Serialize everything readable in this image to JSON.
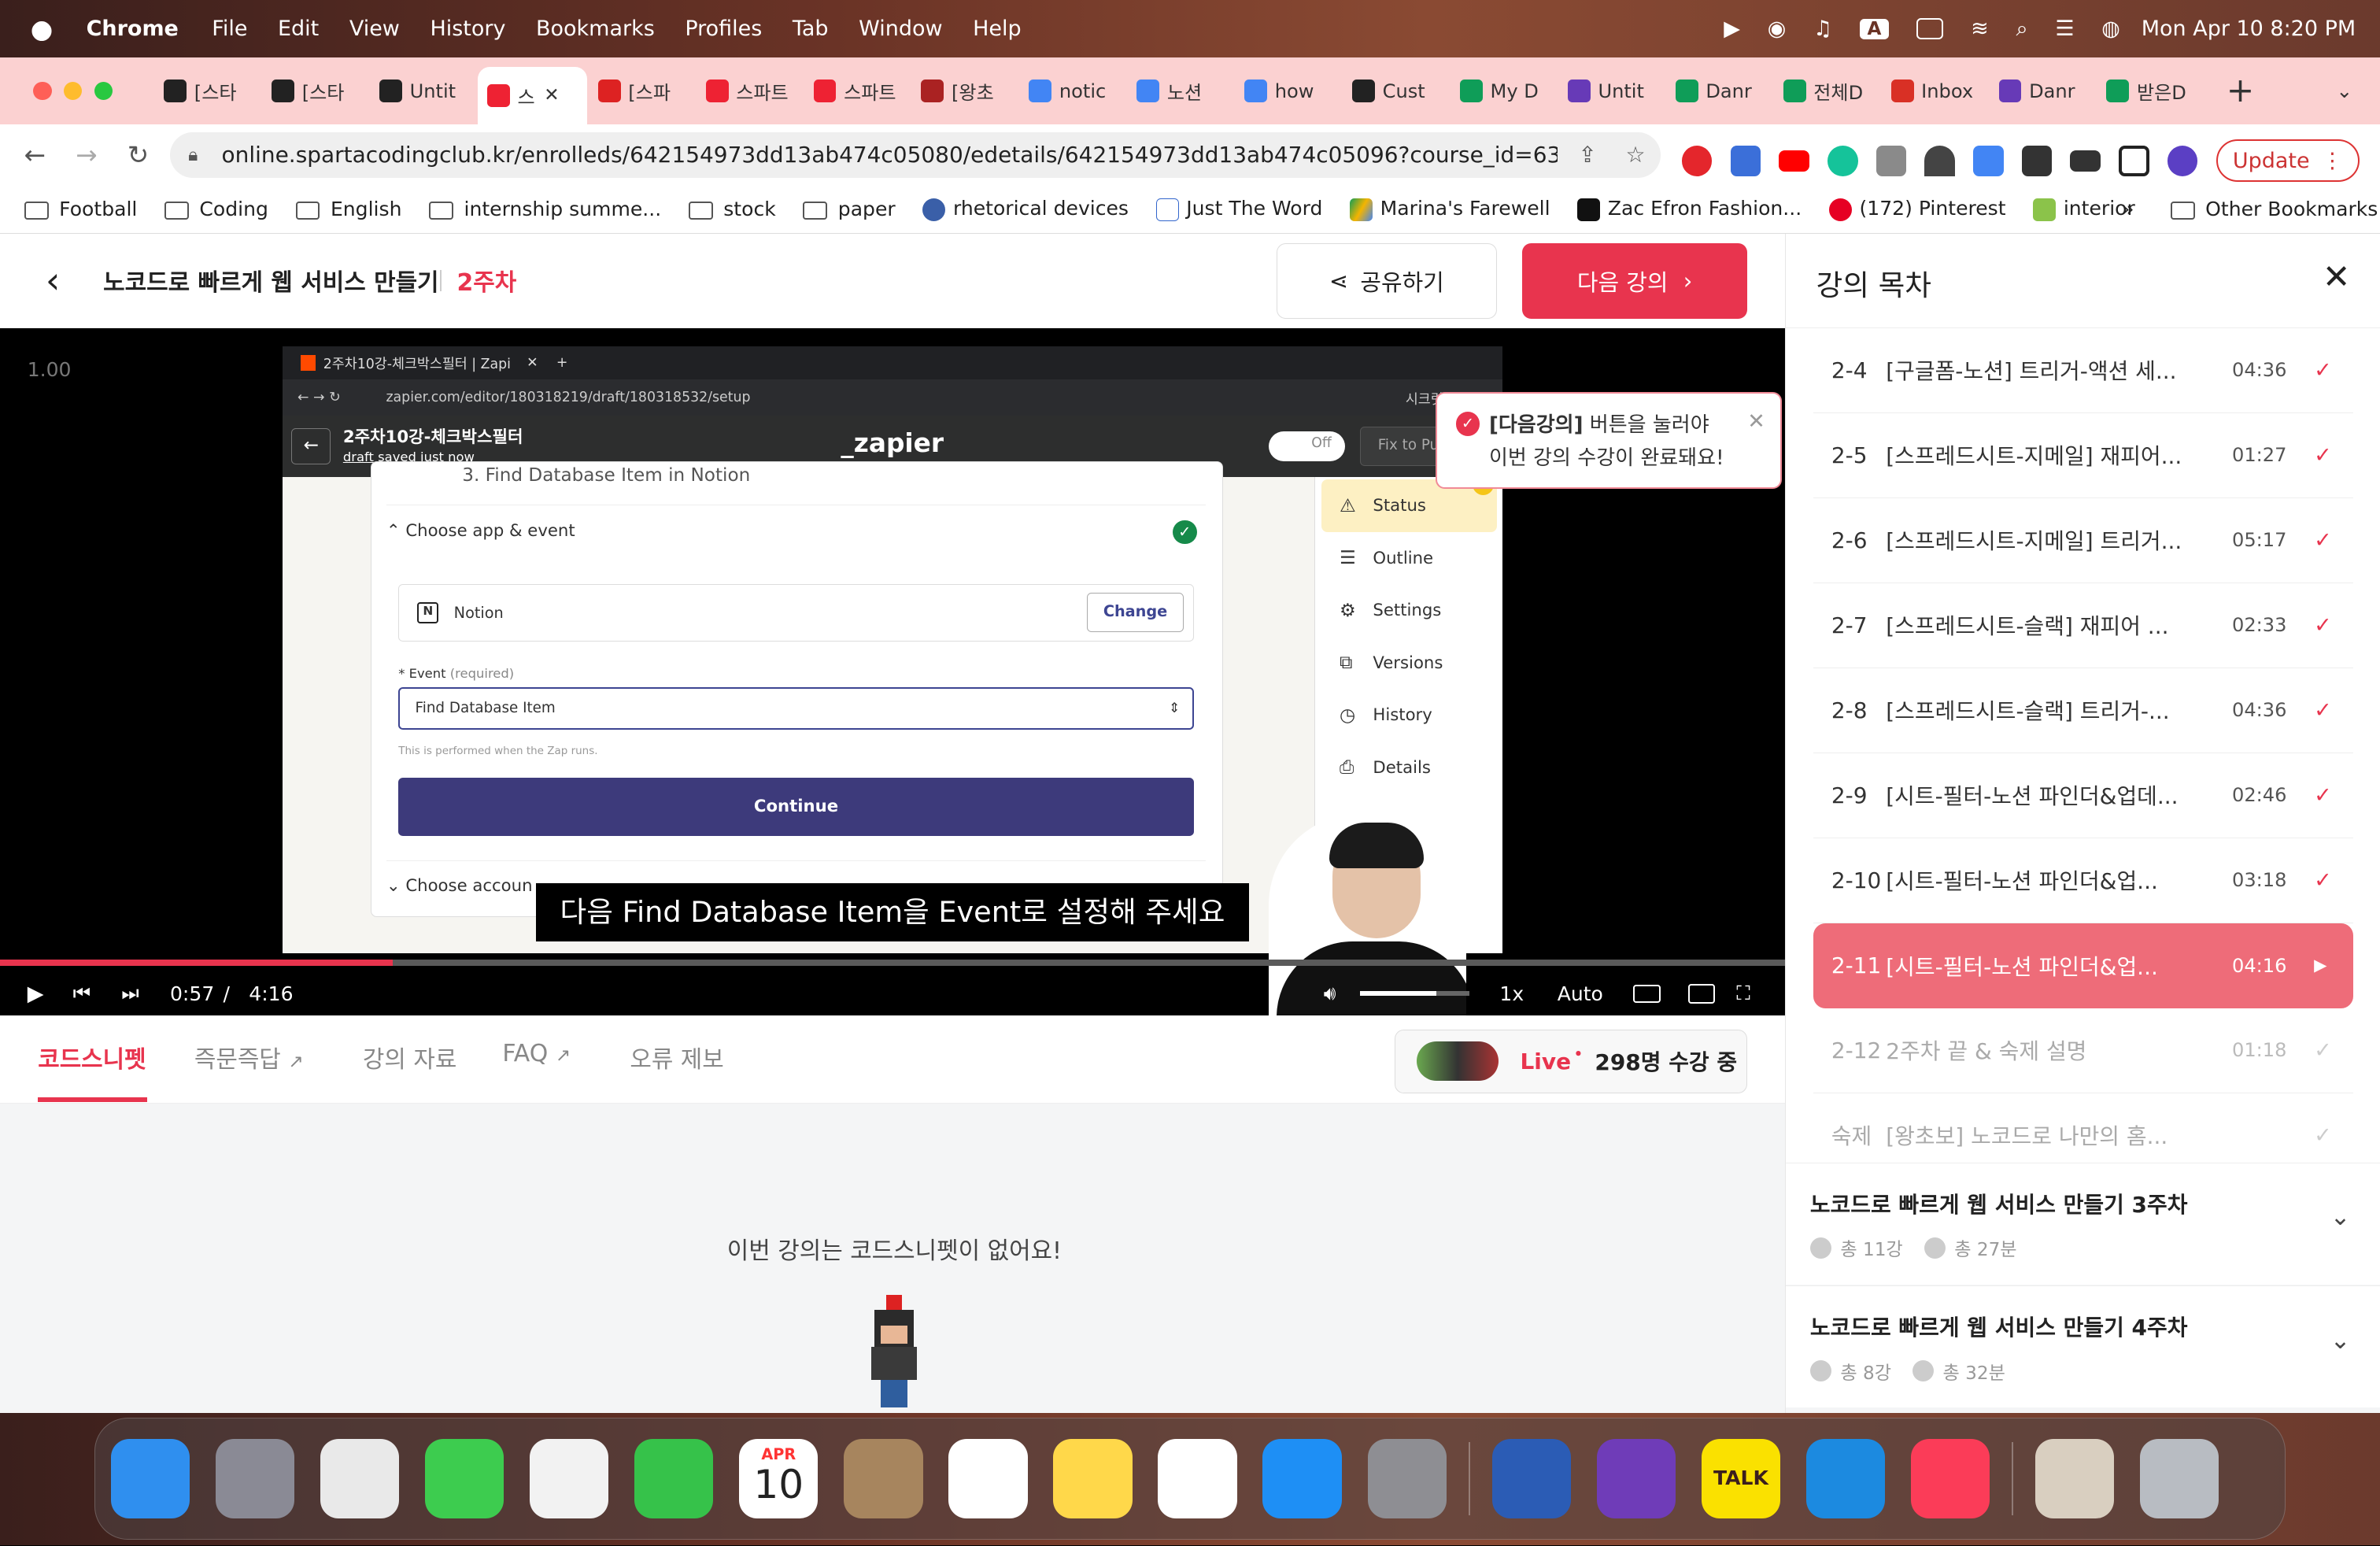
{
  "menubar": {
    "app": "Chrome",
    "items": [
      "File",
      "Edit",
      "View",
      "History",
      "Bookmarks",
      "Profiles",
      "Tab",
      "Window",
      "Help"
    ],
    "clock": "Mon Apr 10  8:20 PM",
    "input_indicator": "A"
  },
  "tabs": [
    {
      "label": "[스타",
      "color": "#222"
    },
    {
      "label": "[스타",
      "color": "#222"
    },
    {
      "label": "Untit",
      "color": "#222"
    },
    {
      "label": "스",
      "color": "#e23",
      "active": true
    },
    {
      "label": "[스파",
      "color": "#d22"
    },
    {
      "label": "스파트",
      "color": "#e23"
    },
    {
      "label": "스파트",
      "color": "#e23"
    },
    {
      "label": "[왕초",
      "color": "#a22"
    },
    {
      "label": "notic",
      "color": "#4285f4"
    },
    {
      "label": "노션",
      "color": "#4285f4"
    },
    {
      "label": "how",
      "color": "#4285f4"
    },
    {
      "label": "Cust",
      "color": "#222"
    },
    {
      "label": "My D",
      "color": "#0f9d58"
    },
    {
      "label": "Untit",
      "color": "#673ab7"
    },
    {
      "label": "Danr",
      "color": "#0f9d58"
    },
    {
      "label": "전체D",
      "color": "#0f9d58"
    },
    {
      "label": "Inbox",
      "color": "#d93025"
    },
    {
      "label": "Danr",
      "color": "#673ab7"
    },
    {
      "label": "받은D",
      "color": "#0f9d58"
    }
  ],
  "url": "online.spartacodingclub.kr/enrolleds/642154973dd13ab474c05080/edetails/642154973dd13ab474c05096?course_id=63d8e...",
  "update_label": "Update",
  "bookmarks": [
    "Football",
    "Coding",
    "English",
    "internship summe...",
    "stock",
    "paper",
    "rhetorical devices",
    "Just The Word",
    "Marina's Farewell",
    "Zac Efron Fashion...",
    "(172) Pinterest",
    "interior"
  ],
  "bookmarks_more": "»",
  "other_bookmarks": "Other Bookmarks",
  "header": {
    "course_title": "노코드로 빠르게 웹 서비스 만들기",
    "week": "2주차",
    "share": "공유하기",
    "next": "다음 강의"
  },
  "tooltip": {
    "bold": "[다음강의]",
    "line1": " 버튼을 눌러야",
    "line2": "이번 강의 수강이 완료돼요!"
  },
  "video": {
    "speed_badge": "1.00",
    "subtitle": "다음 Find Database Item을 Event로 설정해 주세요",
    "time_current": "0:57",
    "time_sep": "/",
    "time_total": "4:16",
    "progress": 0.22,
    "playback_rate": "1x",
    "quality": "Auto",
    "volume": 0.7
  },
  "zapier": {
    "tab_title": "2주차10강-체크박스필터 | Zapi",
    "url": "zapier.com/editor/180318219/draft/180318532/setup",
    "profile": "시크릿 모드(창",
    "zap_name": "2주차10강-체크박스필터",
    "draft": "draft",
    "saved": "saved just now",
    "logo": "_zapier",
    "toggle": "Off",
    "publish": "Fix to Publish",
    "step_title": "3. Find Database Item in Notion",
    "section1": "Choose app & event",
    "app_name": "Notion",
    "change": "Change",
    "event_label": "* Event",
    "event_required": "(required)",
    "event_value": "Find Database Item",
    "hint": "This is performed when the Zap runs.",
    "continue": "Continue",
    "section2": "Choose accoun",
    "side": [
      "Status",
      "Outline",
      "Settings",
      "Versions",
      "History",
      "Details"
    ],
    "status_badge": "1"
  },
  "page_tabs": [
    "코드스니펫",
    "즉문즉답",
    "강의 자료",
    "FAQ",
    "오류 제보"
  ],
  "live": {
    "label": "Live",
    "count": "298명 수강 중"
  },
  "empty_msg": "이번 강의는 코드스니펫이 없어요!",
  "sidebar": {
    "title": "강의 목차",
    "lessons": [
      {
        "num": "2-4",
        "title": "[구글폼-노션] 트리거-액션 세...",
        "dur": "04:36",
        "state": "done"
      },
      {
        "num": "2-5",
        "title": "[스프레드시트-지메일] 재피어...",
        "dur": "01:27",
        "state": "done"
      },
      {
        "num": "2-6",
        "title": "[스프레드시트-지메일] 트리거...",
        "dur": "05:17",
        "state": "done"
      },
      {
        "num": "2-7",
        "title": "[스프레드시트-슬랙] 재피어 ...",
        "dur": "02:33",
        "state": "done"
      },
      {
        "num": "2-8",
        "title": "[스프레드시트-슬랙] 트리거-...",
        "dur": "04:36",
        "state": "done"
      },
      {
        "num": "2-9",
        "title": "[시트-필터-노션 파인더&업데...",
        "dur": "02:46",
        "state": "done"
      },
      {
        "num": "2-10",
        "title": "[시트-필터-노션 파인더&업...",
        "dur": "03:18",
        "state": "done"
      },
      {
        "num": "2-11",
        "title": "[시트-필터-노션 파인더&업...",
        "dur": "04:16",
        "state": "active"
      },
      {
        "num": "2-12",
        "title": "2주차 끝 & 숙제 설명",
        "dur": "01:18",
        "state": "todo"
      },
      {
        "num": "숙제",
        "title": "[왕초보] 노코드로 나만의 홈...",
        "dur": "",
        "state": "todo"
      }
    ],
    "weeks": [
      {
        "title": "노코드로 빠르게 웹 서비스 만들기 3주차",
        "lessons": "총 11강",
        "time": "총 27분"
      },
      {
        "title": "노코드로 빠르게 웹 서비스 만들기 4주차",
        "lessons": "총 8강",
        "time": "총 32분"
      }
    ]
  },
  "dock": {
    "calendar_month": "APR",
    "calendar_day": "10",
    "talk": "TALK",
    "apps": [
      {
        "name": "finder-icon",
        "color": "#2f8fef"
      },
      {
        "name": "launchpad-icon",
        "color": "#8a8a95"
      },
      {
        "name": "chrome-icon",
        "color": "#e9e9e9"
      },
      {
        "name": "messages-icon",
        "color": "#3dcc4f"
      },
      {
        "name": "photos-icon",
        "color": "#f2f2f2"
      },
      {
        "name": "facetime-icon",
        "color": "#36c24a"
      },
      {
        "name": "calendar-icon",
        "color": "#ffffff"
      },
      {
        "name": "contacts-icon",
        "color": "#a7855e"
      },
      {
        "name": "reminders-icon",
        "color": "#ffffff"
      },
      {
        "name": "notes-icon",
        "color": "#ffd84a"
      },
      {
        "name": "freeform-icon",
        "color": "#ffffff"
      },
      {
        "name": "appstore-icon",
        "color": "#1e8ff5"
      },
      {
        "name": "settings-icon",
        "color": "#8e8e93"
      },
      {
        "name": "word-icon",
        "color": "#2b5cb5"
      },
      {
        "name": "visualstudio-icon",
        "color": "#6f3cb8"
      },
      {
        "name": "kakaotalk-icon",
        "color": "#fae100"
      },
      {
        "name": "vscode-icon",
        "color": "#1c8ae0"
      },
      {
        "name": "music-icon",
        "color": "#fb3c58"
      },
      {
        "name": "preview-icon",
        "color": "#d9cfc0"
      },
      {
        "name": "trash-icon",
        "color": "#b8bcc2"
      }
    ]
  }
}
